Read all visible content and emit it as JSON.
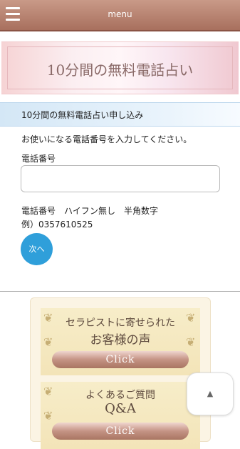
{
  "header": {
    "menu_label": "menu"
  },
  "banner": {
    "title": "10分間の無料電話占い"
  },
  "section": {
    "title": "10分間の無料電話占い申し込み"
  },
  "form": {
    "instruction": "お使いになる電話番号を入力してください。",
    "phone_label": "電話番号",
    "phone_value": "",
    "note_format": "電話番号　ハイフン無し　半角数字",
    "note_example": "例）0357610525",
    "next_label": "次へ"
  },
  "promos": [
    {
      "line1": "セラピストに寄せられた",
      "line2": "お客様の声",
      "button": "Click"
    },
    {
      "line1": "よくあるご質問",
      "line2": "Q&A",
      "button": "Click"
    }
  ],
  "back_to_top": "▲",
  "colors": {
    "header": "#a8705e",
    "accent": "#2f9fda",
    "section_bar": "#d4e7f6",
    "card": "#fbf4e4"
  }
}
